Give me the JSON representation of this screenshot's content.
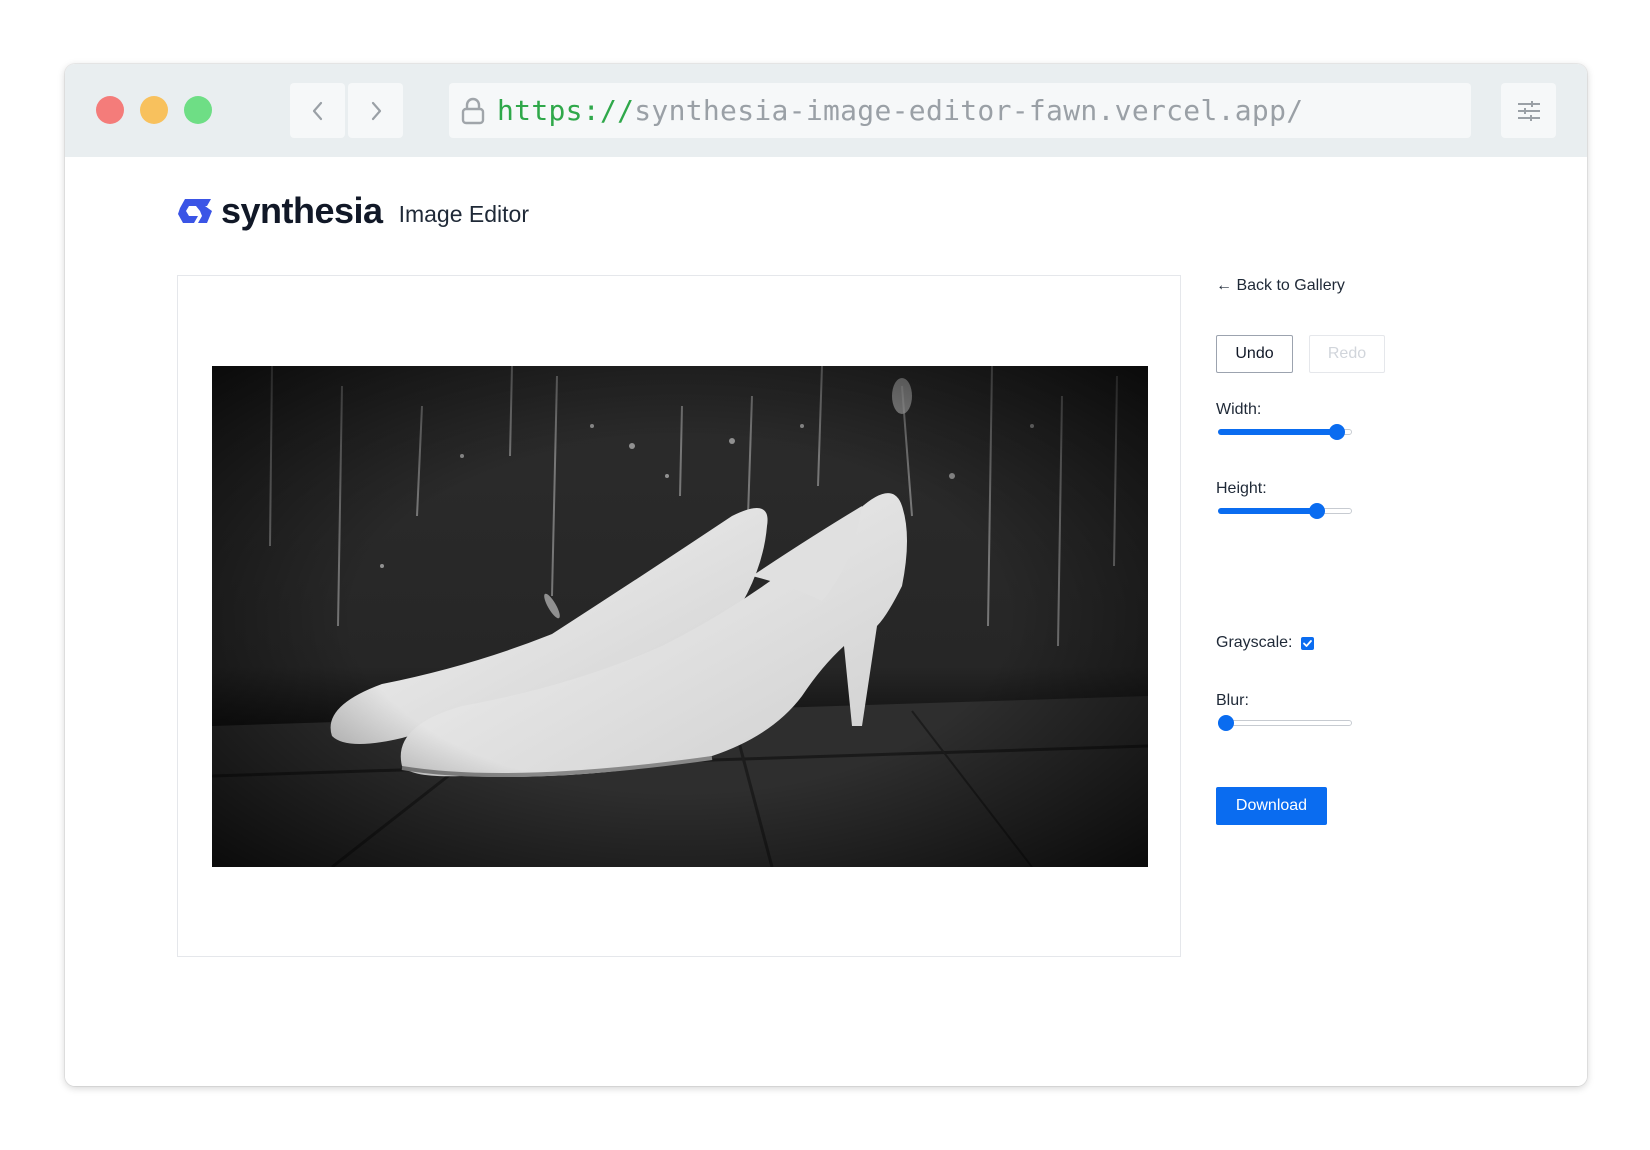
{
  "browser": {
    "url_scheme": "https://",
    "url_host": "synthesia-image-editor-fawn.vercel.app/"
  },
  "header": {
    "brand": "synthesia",
    "subtitle": "Image Editor",
    "brand_color": "#3b55e6"
  },
  "sidebar": {
    "back_label": "← Back to Gallery",
    "undo_label": "Undo",
    "redo_label": "Redo",
    "width_label": "Width:",
    "width_level": 0.94,
    "height_label": "Height:",
    "height_level": 0.77,
    "grayscale_label": "Grayscale:",
    "grayscale_checked": true,
    "blur_label": "Blur:",
    "blur_level": 0.0,
    "download_label": "Download",
    "accent_color": "#0a6cf0"
  }
}
